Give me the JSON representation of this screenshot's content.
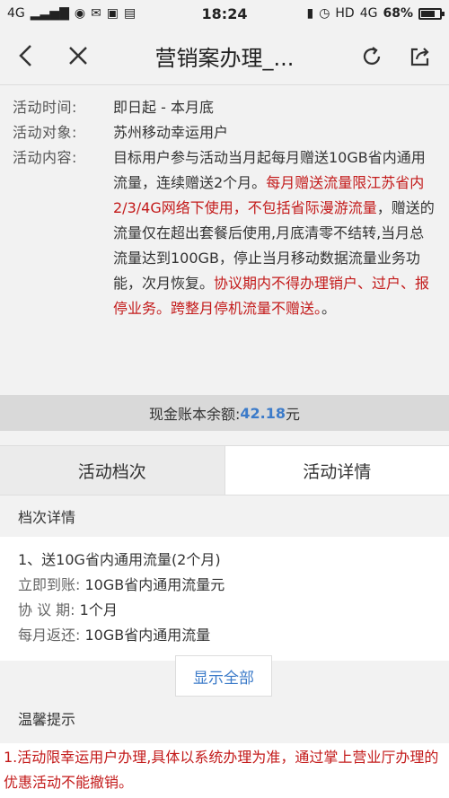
{
  "status_bar": {
    "network": "4G",
    "time": "18:24",
    "hd": "HD",
    "net2": "4G",
    "battery": "68%"
  },
  "nav": {
    "title": "营销案办理_..."
  },
  "info": {
    "time_label": "活动时间:",
    "time_value": "即日起 - 本月底",
    "target_label": "活动对象:",
    "target_value": "苏州移动幸运用户",
    "content_label": "活动内容:",
    "content_1": "目标用户参与活动当月起每月赠送10GB省内通用流量，连续赠送2个月。",
    "content_red_1": "每月赠送流量限江苏省内2/3/4G网络下使用，不包括省际漫游流量",
    "content_2": "，赠送的流量仅在超出套餐后使用,月底清零不结转,当月总流量达到100GB，停止当月移动数据流量业务功能，次月恢复。",
    "content_red_2": "协议期内不得办理销户、过户、报停业务。跨整月停机流量不赠送。",
    "content_3": "。"
  },
  "balance": {
    "label": "现金账本余额: ",
    "amount": "42.18",
    "unit": "元"
  },
  "tabs": {
    "tier": "活动档次",
    "details": "活动详情"
  },
  "tier": {
    "title": "档次详情",
    "item": "1、送10G省内通用流量(2个月)",
    "immediate_label": "立即到账: ",
    "immediate_value": "10GB省内通用流量元",
    "period_label": "协 议 期: ",
    "period_value": "1个月",
    "monthly_label": "每月返还: ",
    "monthly_value": "10GB省内通用流量"
  },
  "show_all": "显示全部",
  "tips": {
    "title": "温馨提示",
    "text": "1.活动限幸运用户办理,具体以系统办理为准，通过掌上营业厅办理的优惠活动不能撤销。"
  },
  "colors": {
    "red": "#c31a1a",
    "blue": "#3c7bc9"
  }
}
